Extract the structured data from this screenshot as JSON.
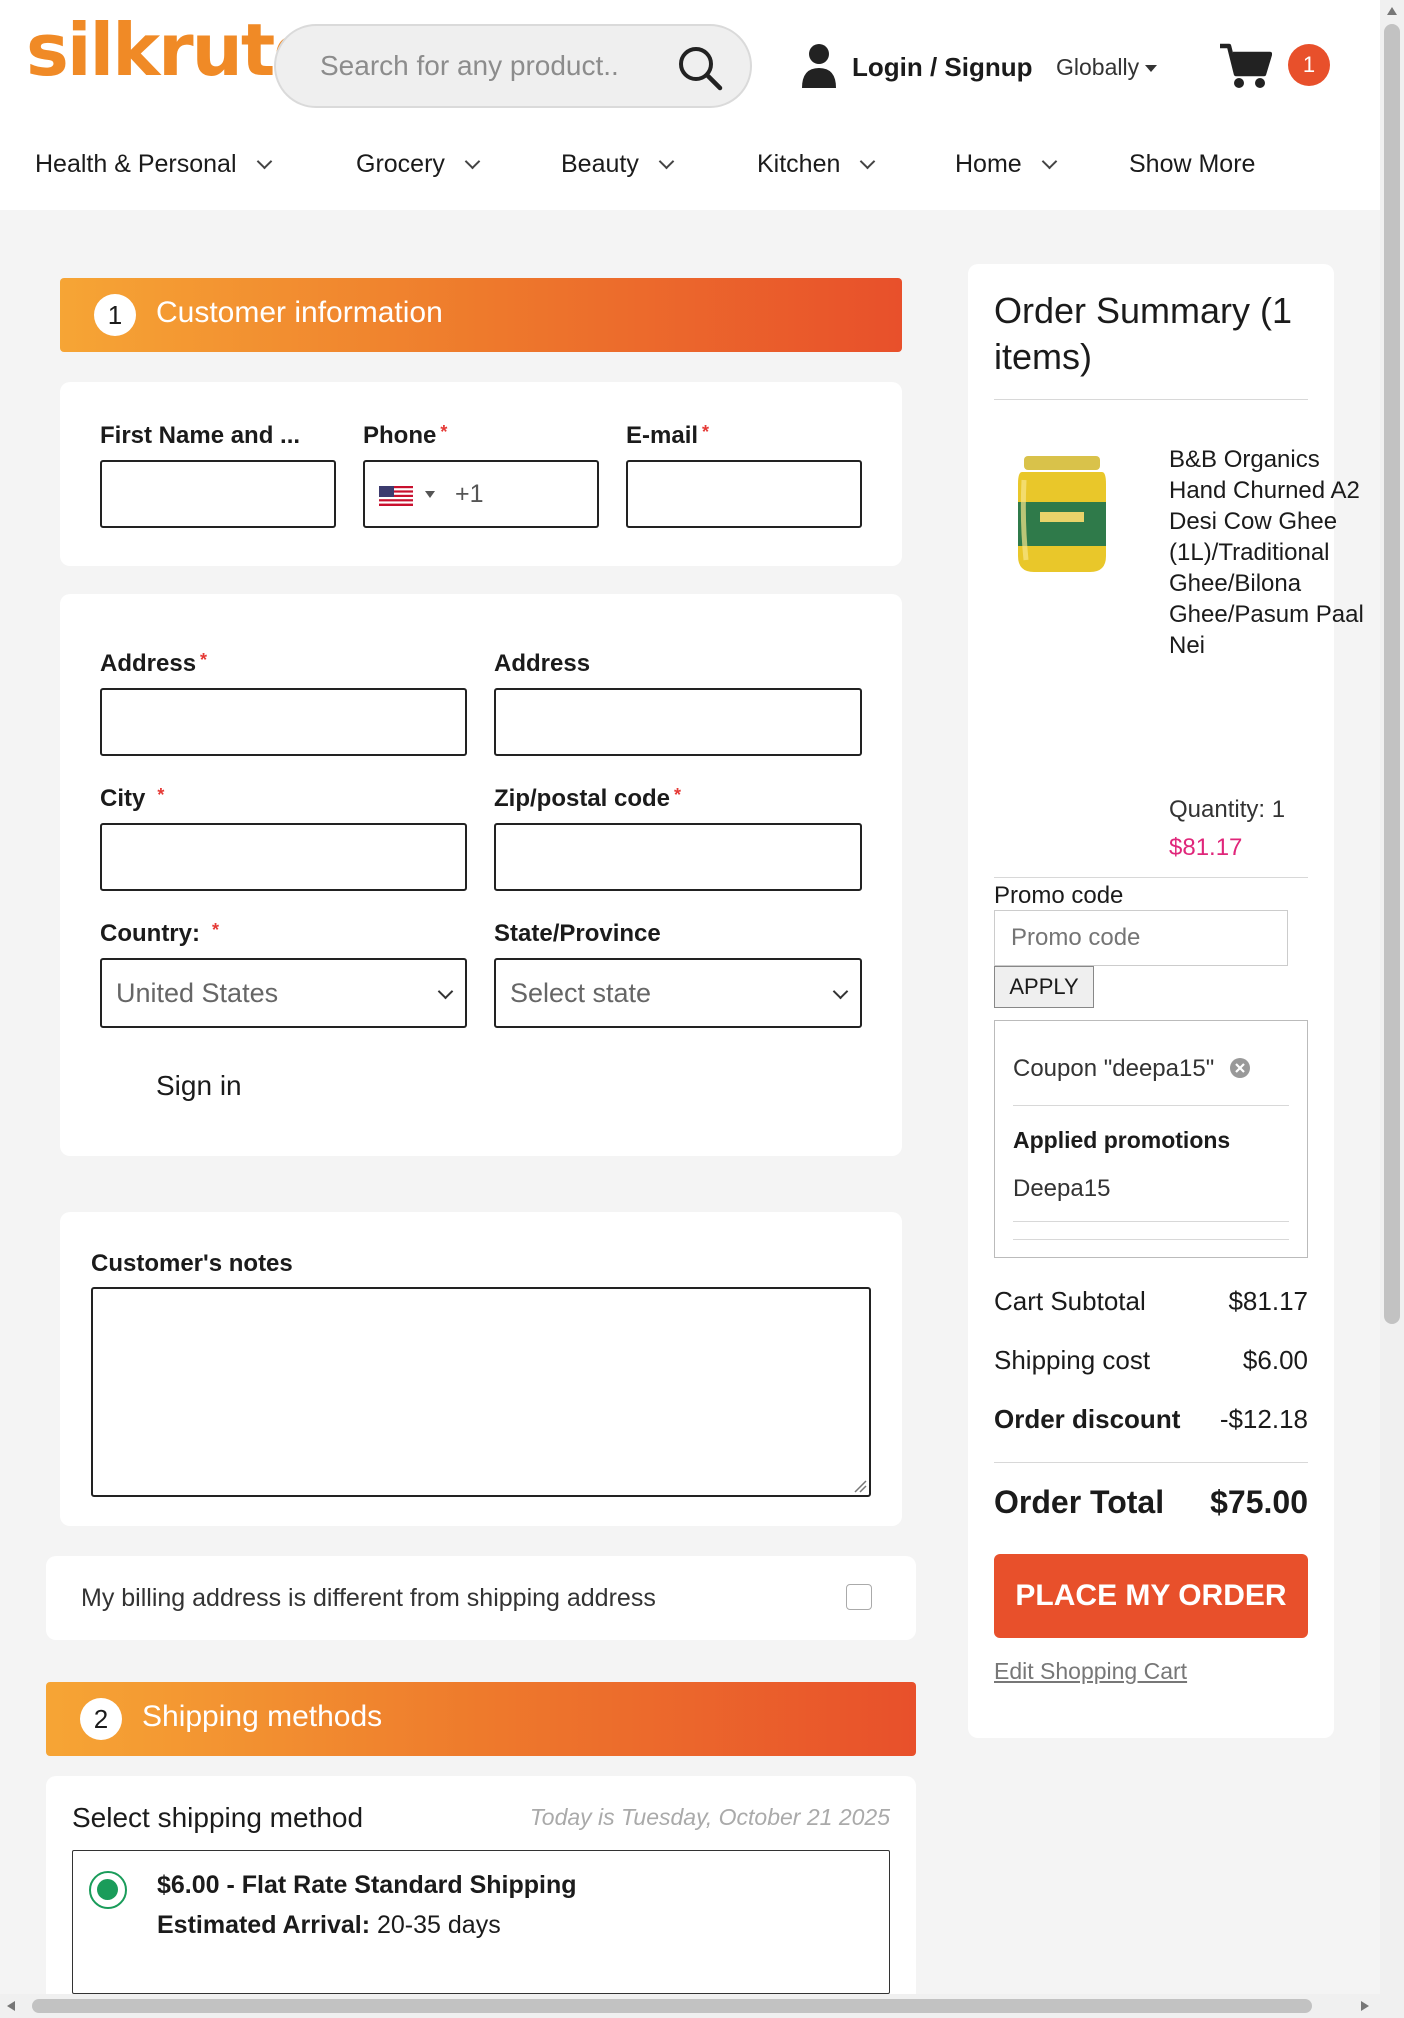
{
  "header": {
    "logo": "silkrute",
    "search_placeholder": "Search for any product..",
    "login_label": "Login / Signup",
    "region_label": "Globally",
    "cart_count": "1"
  },
  "nav": [
    {
      "label": "Health & Personal"
    },
    {
      "label": "Grocery"
    },
    {
      "label": "Beauty"
    },
    {
      "label": "Kitchen"
    },
    {
      "label": "Home"
    },
    {
      "label": "Show More"
    }
  ],
  "customer": {
    "step": "1",
    "title": "Customer information",
    "first_name_label": "First Name and ...",
    "phone_label": "Phone",
    "phone_code": "+1",
    "email_label": "E-mail",
    "address1_label": "Address",
    "address2_label": "Address",
    "city_label": "City",
    "zip_label": "Zip/postal code",
    "country_label": "Country:",
    "country_value": "United States",
    "state_label": "State/Province",
    "state_value": "Select state",
    "sign_in_label": "Sign in",
    "notes_label": "Customer's notes",
    "billing_label": "My billing address is different from shipping address"
  },
  "shipping": {
    "step": "2",
    "title": "Shipping methods",
    "select_label": "Select shipping method",
    "today_label": "Today is Tuesday, October 21 2025",
    "method_label": "$6.00 - Flat Rate Standard Shipping",
    "arrival_label": "Estimated Arrival:",
    "arrival_value": "20-35 days"
  },
  "summary": {
    "title": "Order Summary (1 items)",
    "product_name": "B&B Organics Hand Churned A2 Desi Cow Ghee (1L)/Traditional Ghee/Bilona Ghee/Pasum Paal Nei",
    "quantity_label": "Quantity: 1",
    "price": "$81.17",
    "promo_label": "Promo code",
    "promo_placeholder": "Promo code",
    "apply_label": "APPLY",
    "coupon_label": "Coupon \"deepa15\"",
    "applied_title": "Applied promotions",
    "applied_item": "Deepa15",
    "subtotal_label": "Cart Subtotal",
    "subtotal_value": "$81.17",
    "shipping_label": "Shipping cost",
    "shipping_value": "$6.00",
    "discount_label": "Order discount",
    "discount_value": "-$12.18",
    "total_label": "Order Total",
    "total_value": "$75.00",
    "place_order_label": "PLACE MY ORDER",
    "edit_cart_label": "Edit Shopping Cart"
  },
  "colors": {
    "accent": "#e8502b",
    "accent_light": "#f6a535",
    "price": "#e0267a",
    "radio": "#1a9c5a"
  }
}
